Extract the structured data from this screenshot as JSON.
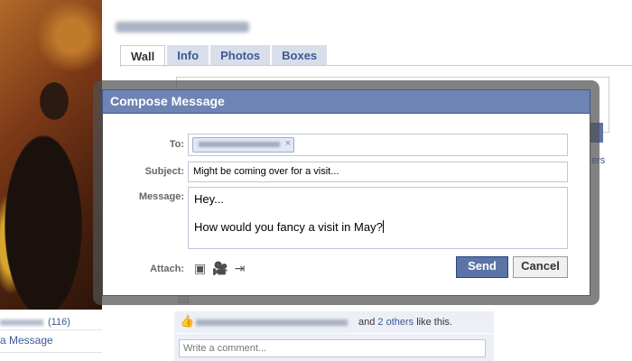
{
  "tabs": [
    "Wall",
    "Info",
    "Photos",
    "Boxes"
  ],
  "sidebar": {
    "friend_count": "(116)",
    "send_message": "a Message"
  },
  "background": {
    "partial_text": "ers"
  },
  "likes": {
    "text_and": "and",
    "others_link": "2 others",
    "text_suffix": "like this."
  },
  "comment": {
    "placeholder": "Write a comment..."
  },
  "dialog": {
    "title": "Compose Message",
    "to_label": "To:",
    "to_remove": "×",
    "subject_label": "Subject:",
    "subject_value": "Might be coming over for a visit...",
    "message_label": "Message:",
    "message_line1": "Hey...",
    "message_line2": "How would you fancy a visit in May?",
    "attach_label": "Attach:",
    "attach_icons": [
      "photo-icon",
      "video-icon",
      "link-icon"
    ],
    "send_label": "Send",
    "cancel_label": "Cancel"
  },
  "colors": {
    "brand": "#3b5998",
    "dialog_header": "#6d84b4",
    "send_button": "#5b74a8"
  }
}
